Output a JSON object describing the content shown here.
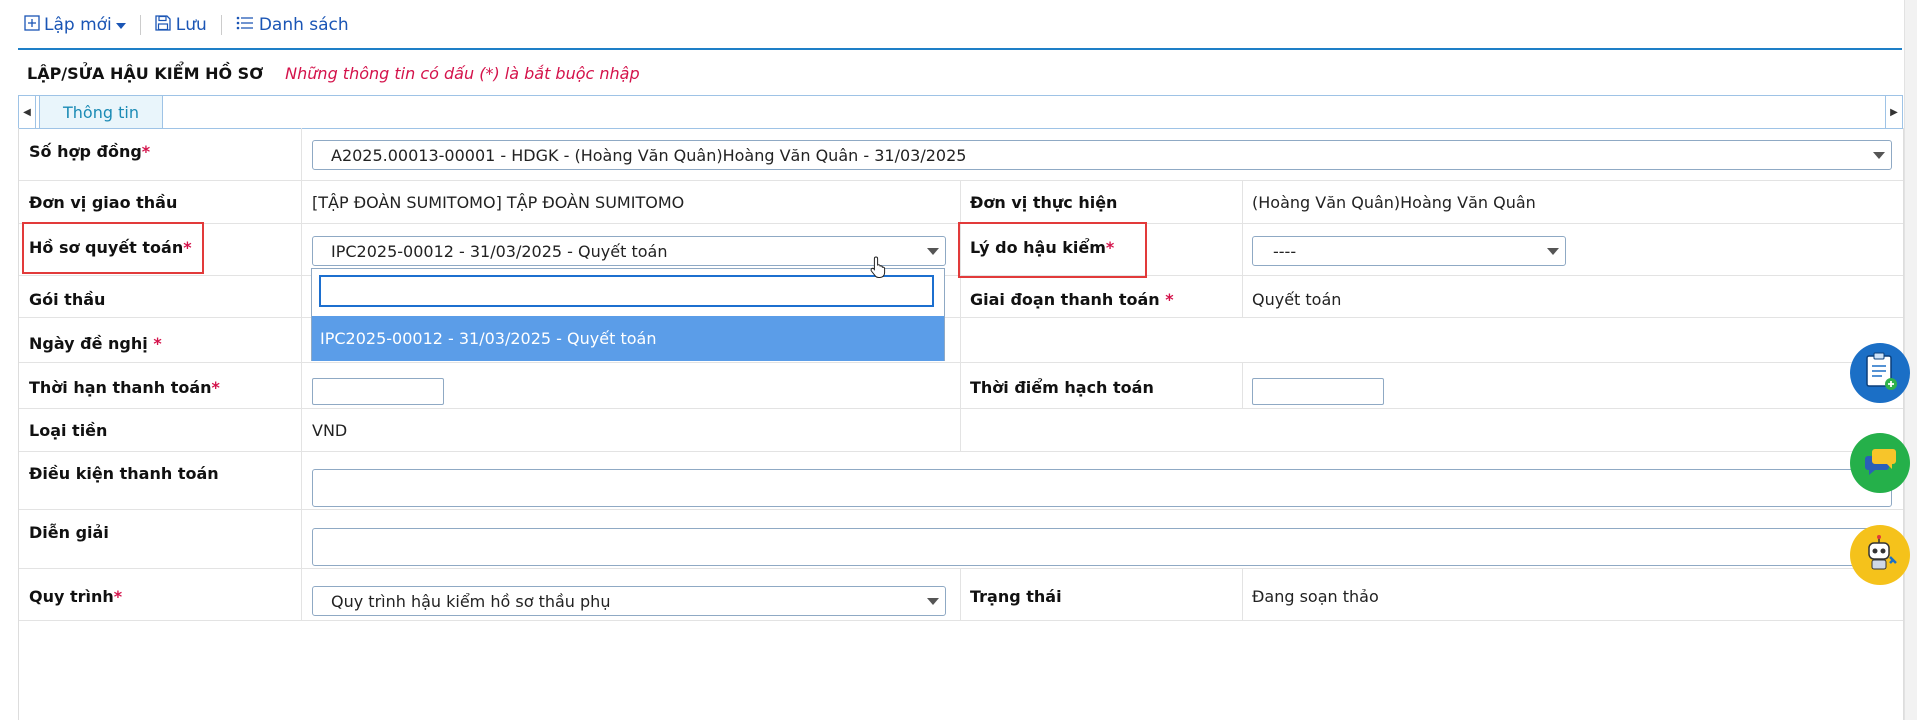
{
  "toolbar": {
    "new_label": "Lập mới",
    "save_label": "Lưu",
    "list_label": "Danh sách"
  },
  "header": {
    "title": "LẬP/SỬA HẬU KIỂM HỒ SƠ",
    "note": "Những thông tin có dấu (*) là bắt buộc nhập"
  },
  "tabs": [
    {
      "label": "Thông tin"
    }
  ],
  "form": {
    "contract_label": "Số hợp đồng",
    "contract_value": "A2025.00013-00001 - HDGK - (Hoàng Văn Quân)Hoàng Văn Quân - 31/03/2025",
    "contractor_unit_label": "Đơn vị giao thầu",
    "contractor_unit_value": "[TẬP ĐOÀN SUMITOMO] TẬP ĐOÀN SUMITOMO",
    "performer_label": "Đơn vị thực hiện",
    "performer_value": "(Hoàng Văn Quân)Hoàng Văn Quân",
    "settlement_label": "Hồ sơ quyết toán",
    "settlement_value": "IPC2025-00012 - 31/03/2025 - Quyết toán",
    "reason_label": "Lý do hậu kiểm",
    "reason_value": "----",
    "package_label": "Gói thầu",
    "payment_phase_label": "Giai đoạn thanh toán",
    "payment_phase_value": "Quyết toán",
    "request_date_label": "Ngày đề nghị",
    "payment_term_label": "Thời hạn thanh toán",
    "accounting_time_label": "Thời điểm hạch toán",
    "currency_label": "Loại tiền",
    "currency_value": "VND",
    "payment_condition_label": "Điều kiện thanh toán",
    "description_label": "Diễn giải",
    "process_label": "Quy trình",
    "process_value": "Quy trình hậu kiểm hồ sơ thầu phụ",
    "status_label": "Trạng thái",
    "status_value": "Đang soạn thảo",
    "required_mark": "*"
  },
  "dropdown": {
    "search_value": "",
    "options": [
      "IPC2025-00012 - 31/03/2025 - Quyết toán"
    ]
  },
  "colors": {
    "accent": "#1e7fc7",
    "required": "#d4134b",
    "highlight_box": "#e23a3a",
    "selected_option": "#5b9de8"
  }
}
